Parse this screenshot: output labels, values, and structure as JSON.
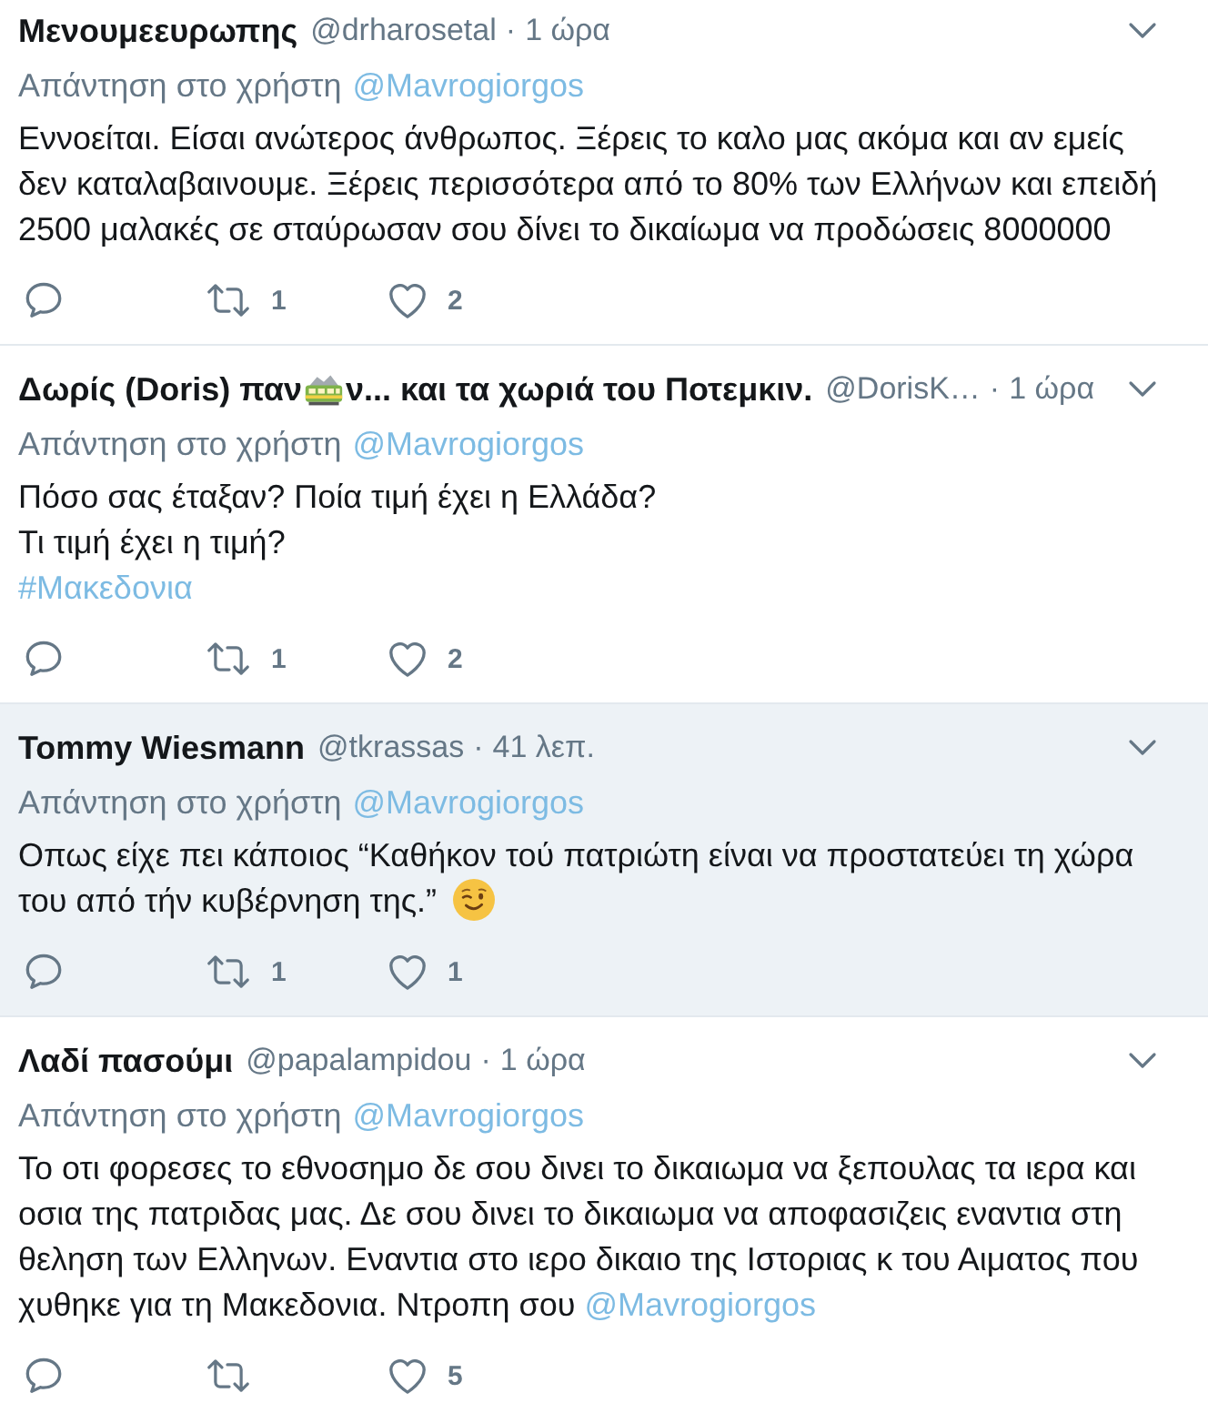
{
  "tweets": [
    {
      "highlighted": false,
      "author": {
        "name": [
          {
            "kind": "text",
            "text": "Μενουμεευρωπης"
          }
        ],
        "handle": "@drharosetal"
      },
      "separator": "·",
      "time": "1 ώρα",
      "reply_to": {
        "label": "Απάντηση στο χρήστη",
        "mention": "@Mavrogiorgos"
      },
      "body": [
        {
          "kind": "text",
          "text": "Εννοείται. Είσαι ανώτερος άνθρωπος. Ξέρεις το καλο μας ακόμα και αν εμείς\nδεν καταλαβαινουμε. Ξέρεις περισσότερα από το 80% των Ελλήνων και επειδή\n2500 μαλακές σε σταύρωσαν σου δίνει το δικαίωμα να προδώσεις 8000000"
        }
      ],
      "actions": [
        {
          "kind": "reply"
        },
        {
          "kind": "retweet",
          "count": "1"
        },
        {
          "kind": "like",
          "count": "2"
        }
      ]
    },
    {
      "highlighted": false,
      "author": {
        "name": [
          {
            "kind": "text",
            "text": "Δωρίς (Doris) παν"
          },
          {
            "kind": "train"
          },
          {
            "kind": "text",
            "text": "ν... και τα χωριά του Ποτεμκιν."
          }
        ],
        "handle": "@DorisK…"
      },
      "separator": "·",
      "time": "1 ώρα",
      "reply_to": {
        "label": "Απάντηση στο χρήστη",
        "mention": "@Mavrogiorgos"
      },
      "body": [
        {
          "kind": "text",
          "text": "Πόσο σας έταξαν? Ποία τιμή έχει η Ελλάδα?\nΤι τιμή έχει η τιμή?\n"
        },
        {
          "kind": "hashtag",
          "text": "#Μακεδονια"
        }
      ],
      "actions": [
        {
          "kind": "reply"
        },
        {
          "kind": "retweet",
          "count": "1"
        },
        {
          "kind": "like",
          "count": "2"
        }
      ]
    },
    {
      "highlighted": true,
      "author": {
        "name": [
          {
            "kind": "text",
            "text": "Tommy Wiesmann"
          }
        ],
        "handle": "@tkrassas"
      },
      "separator": "·",
      "time": "41 λεπ.",
      "reply_to": {
        "label": "Απάντηση στο χρήστη",
        "mention": "@Mavrogiorgos"
      },
      "body": [
        {
          "kind": "text",
          "text": "Οπως είχε πει κάποιος “Καθήκον τού πατριώτη είναι να προστατεύει τη χώρα\nτου από τήν κυβέρνηση της.”"
        },
        {
          "kind": "wink"
        }
      ],
      "actions": [
        {
          "kind": "reply"
        },
        {
          "kind": "retweet",
          "count": "1"
        },
        {
          "kind": "like",
          "count": "1"
        }
      ]
    },
    {
      "highlighted": false,
      "author": {
        "name": [
          {
            "kind": "text",
            "text": "Λαδί πασούμι"
          }
        ],
        "handle": "@papalampidou"
      },
      "separator": "·",
      "time": "1 ώρα",
      "reply_to": {
        "label": "Απάντηση στο χρήστη",
        "mention": "@Mavrogiorgos"
      },
      "body": [
        {
          "kind": "text",
          "text": "Το οτι φορεσες το εθνοσημο δε σου δινει το δικαιωμα να ξεπουλας τα ιερα και\nοσια της πατριδας μας. Δε σου δινει το δικαιωμα να αποφασιζεις εναντια στη\nθεληση των Ελληνων. Εναντια στο ιερο δικαιο της Ιστοριας κ του Αιματος που\nχυθηκε για τη Μακεδονια. Ντροπη σου "
        },
        {
          "kind": "mention",
          "text": "@Mavrogiorgos"
        }
      ],
      "actions": [
        {
          "kind": "reply"
        },
        {
          "kind": "retweet"
        },
        {
          "kind": "like",
          "count": "5"
        }
      ]
    }
  ]
}
